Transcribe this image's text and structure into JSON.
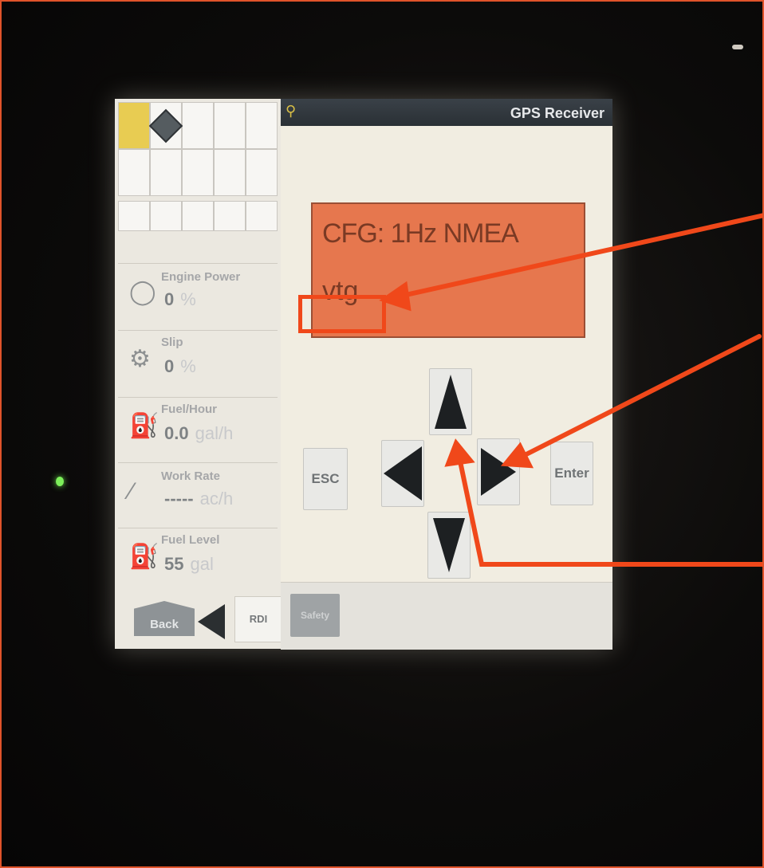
{
  "header": {
    "title": "GPS Receiver"
  },
  "display": {
    "line1": "CFG: 1Hz NMEA",
    "line2": "vtg"
  },
  "metrics": [
    {
      "label": "Engine Power",
      "value": "0",
      "unit": "%",
      "icon": "engine-icon"
    },
    {
      "label": "Slip",
      "value": "0",
      "unit": "%",
      "icon": "tractor-slip-icon"
    },
    {
      "label": "Fuel/Hour",
      "value": "0.0",
      "unit": "gal/h",
      "icon": "fuel-pump-hourglass-icon"
    },
    {
      "label": "Work Rate",
      "value": "-----",
      "unit": "ac/h",
      "icon": "work-rate-icon"
    },
    {
      "label": "Fuel Level",
      "value": "55",
      "unit": "gal",
      "icon": "fuel-level-icon"
    }
  ],
  "controls": {
    "esc": "ESC",
    "enter": "Enter"
  },
  "footer": {
    "back": "Back",
    "rdi": "RDI",
    "safety": "Safety"
  },
  "colors": {
    "display_bg": "#e6774e",
    "annotation": "#f0481a",
    "title_bar": "#2f353a",
    "active_cell": "#e8cc52"
  }
}
